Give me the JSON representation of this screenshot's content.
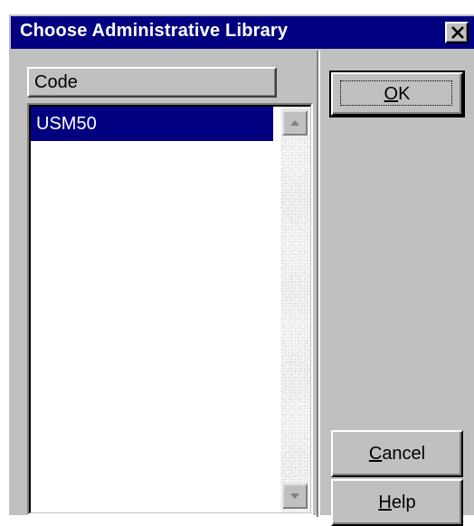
{
  "dialog": {
    "title": "Choose Administrative Library"
  },
  "list": {
    "column_header": "Code",
    "items": [
      "USM50"
    ],
    "selected_index": 0
  },
  "buttons": {
    "ok": {
      "mnemonic": "O",
      "rest": "K"
    },
    "cancel": {
      "mnemonic": "C",
      "rest": "ancel"
    },
    "help": {
      "mnemonic": "H",
      "rest": "elp"
    }
  },
  "colors": {
    "titlebar": "#000080",
    "selection": "#000080",
    "face": "#c0c0c0"
  },
  "icons": {
    "close": "close-icon",
    "scroll_up": "scroll-up-arrow-icon",
    "scroll_down": "scroll-down-arrow-icon"
  }
}
